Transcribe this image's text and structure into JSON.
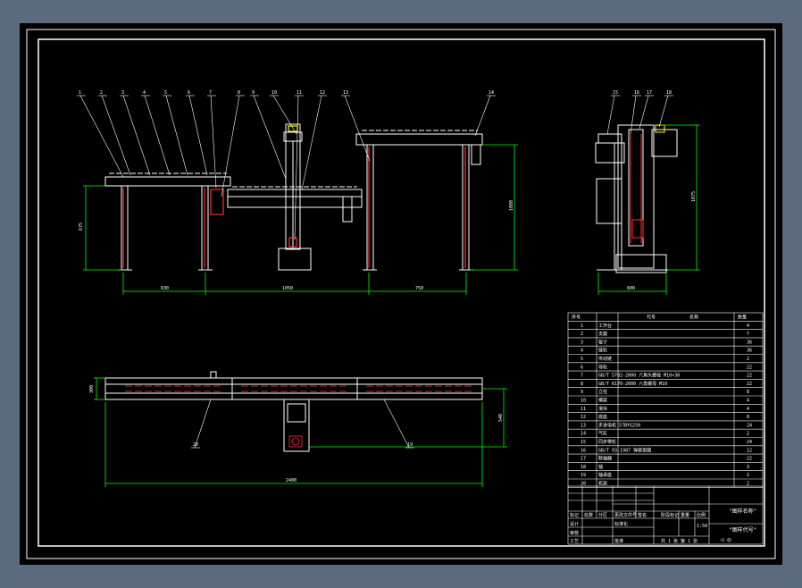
{
  "balloons": {
    "front": [
      "1",
      "2",
      "3",
      "4",
      "5",
      "6",
      "7",
      "8",
      "9",
      "10",
      "11",
      "12",
      "13",
      "14"
    ],
    "side": [
      "15",
      "16",
      "17",
      "18"
    ],
    "plan": [
      "20",
      "19"
    ]
  },
  "dims": {
    "front_h1": "675",
    "front_w1": "830",
    "front_w2": "1050",
    "front_w3": "750",
    "front_h2": "1080",
    "side_w": "600",
    "side_h": "1075",
    "plan_w": "2400",
    "plan_h": "540",
    "plan_depth": "300"
  },
  "bom": {
    "headers": [
      "序号",
      "代号",
      "名称",
      "数量"
    ],
    "rows": [
      {
        "no": "1",
        "name": "工作台",
        "qty": "4"
      },
      {
        "no": "2",
        "name": "支腿",
        "qty": "7"
      },
      {
        "no": "3",
        "name": "辊子",
        "qty": "36"
      },
      {
        "no": "4",
        "name": "链轮",
        "qty": "36"
      },
      {
        "no": "5",
        "name": "传动链",
        "qty": "2"
      },
      {
        "no": "6",
        "name": "导轨",
        "qty": "22"
      },
      {
        "no": "7",
        "name": "GB/T 5782-2000 六角头螺栓 M10×30",
        "qty": "22"
      },
      {
        "no": "8",
        "name": "GB/T 6170-2000 六角螺母 M10",
        "qty": "22"
      },
      {
        "no": "9",
        "name": "立柱",
        "qty": "8"
      },
      {
        "no": "10",
        "name": "横梁",
        "qty": "4"
      },
      {
        "no": "11",
        "name": "滑块",
        "qty": "4"
      },
      {
        "no": "12",
        "name": "底座",
        "qty": "8"
      },
      {
        "no": "13",
        "name": "步进电机 57BYG250",
        "qty": "24"
      },
      {
        "no": "14",
        "name": "气缸",
        "qty": "2"
      },
      {
        "no": "15",
        "name": "同步带轮",
        "qty": "24"
      },
      {
        "no": "16",
        "name": "GB/T 93-1987 弹簧垫圈",
        "qty": "12"
      },
      {
        "no": "17",
        "name": "联轴器",
        "qty": "22"
      },
      {
        "no": "18",
        "name": "轴",
        "qty": "3"
      },
      {
        "no": "19",
        "name": "轴承座",
        "qty": "2"
      },
      {
        "no": "20",
        "name": "机架",
        "qty": "2"
      }
    ]
  },
  "title_block": {
    "drawing_name": "\"图样名称\"",
    "drawing_code": "\"图样代号\"",
    "company": "",
    "stage_label": "阶段标记",
    "weight_label": "重量",
    "scale_label": "比例",
    "scale_value": "1:50",
    "sheet_text": "共 1 张   第 1 张",
    "rows": [
      "标记",
      "设计",
      "审核",
      "工艺"
    ],
    "cols": [
      "处数",
      "分区",
      "更改文件号",
      "签名",
      "年月日"
    ],
    "standardize": "标准化",
    "approve": "批准",
    "projection": "◁ ◎"
  },
  "colors": {
    "frame": "#ffffff",
    "machine": "#ffffff",
    "dimension": "#00ff00",
    "part": "#ff3030",
    "highlight": "#ffff00",
    "paper": "#000000",
    "surround": "#5b6a7c"
  }
}
